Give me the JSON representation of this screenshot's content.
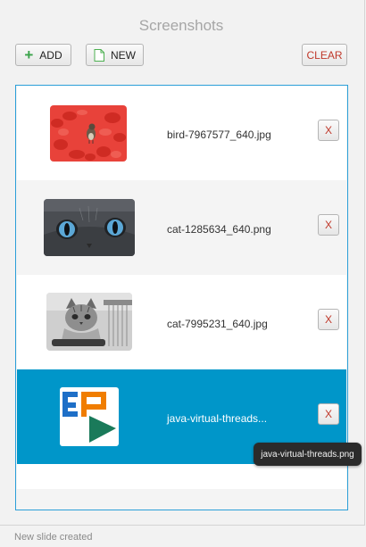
{
  "window": {
    "title": "Screenshots"
  },
  "toolbar": {
    "add_label": "ADD",
    "new_label": "NEW",
    "clear_label": "CLEAR"
  },
  "list": {
    "items": [
      {
        "name": "bird-7967577_640.jpg",
        "remove_label": "X",
        "thumbnail": "bird-on-red-tulips"
      },
      {
        "name": "cat-1285634_640.png",
        "remove_label": "X",
        "thumbnail": "cat-face-blue-eyes"
      },
      {
        "name": "cat-7995231_640.jpg",
        "remove_label": "X",
        "thumbnail": "tabby-cat-grayscale"
      },
      {
        "name": "java-virtual-threads...",
        "remove_label": "X",
        "thumbnail": "ep-logo",
        "selected": true
      }
    ]
  },
  "tooltip": {
    "text": "java-virtual-threads.png"
  },
  "status": {
    "text": "New slide created"
  },
  "colors": {
    "selection": "#0096c9",
    "list_border": "#2b9fd8",
    "remove_text": "#c0392b",
    "add_icon": "#3aa34a"
  }
}
